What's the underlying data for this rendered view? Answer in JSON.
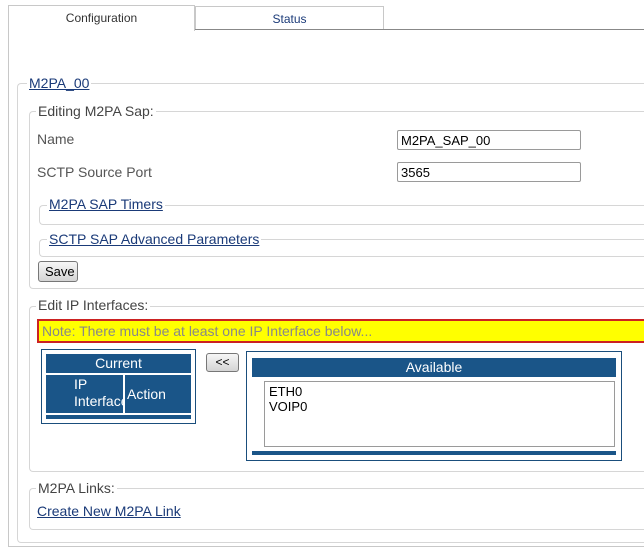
{
  "tabs": [
    {
      "label": "Configuration",
      "active": true
    },
    {
      "label": "Status",
      "active": false
    }
  ],
  "sap_section": {
    "title": "M2PA_00",
    "editing_legend": "Editing M2PA Sap:",
    "fields": {
      "name_label": "Name",
      "name_value": "M2PA_SAP_00",
      "port_label": "SCTP Source Port",
      "port_value": "3565"
    },
    "timers_link": "M2PA SAP Timers",
    "advanced_link": "SCTP SAP Advanced Parameters",
    "save_label": "Save"
  },
  "ip_interfaces": {
    "legend": "Edit IP Interfaces:",
    "note": "Note: There must be at least one IP Interface below...",
    "current_table": {
      "title": "Current",
      "columns": [
        "IP Interface",
        "Action"
      ]
    },
    "move_button": "<<",
    "available": {
      "title": "Available",
      "items": [
        "ETH0",
        "VOIP0"
      ]
    }
  },
  "links_section": {
    "legend": "M2PA Links:",
    "create_link": "Create New M2PA Link"
  },
  "colors": {
    "header_blue": "#1a5588",
    "note_yellow": "#ffff00",
    "note_border": "#cc2222",
    "link_blue": "#1a3a78"
  }
}
